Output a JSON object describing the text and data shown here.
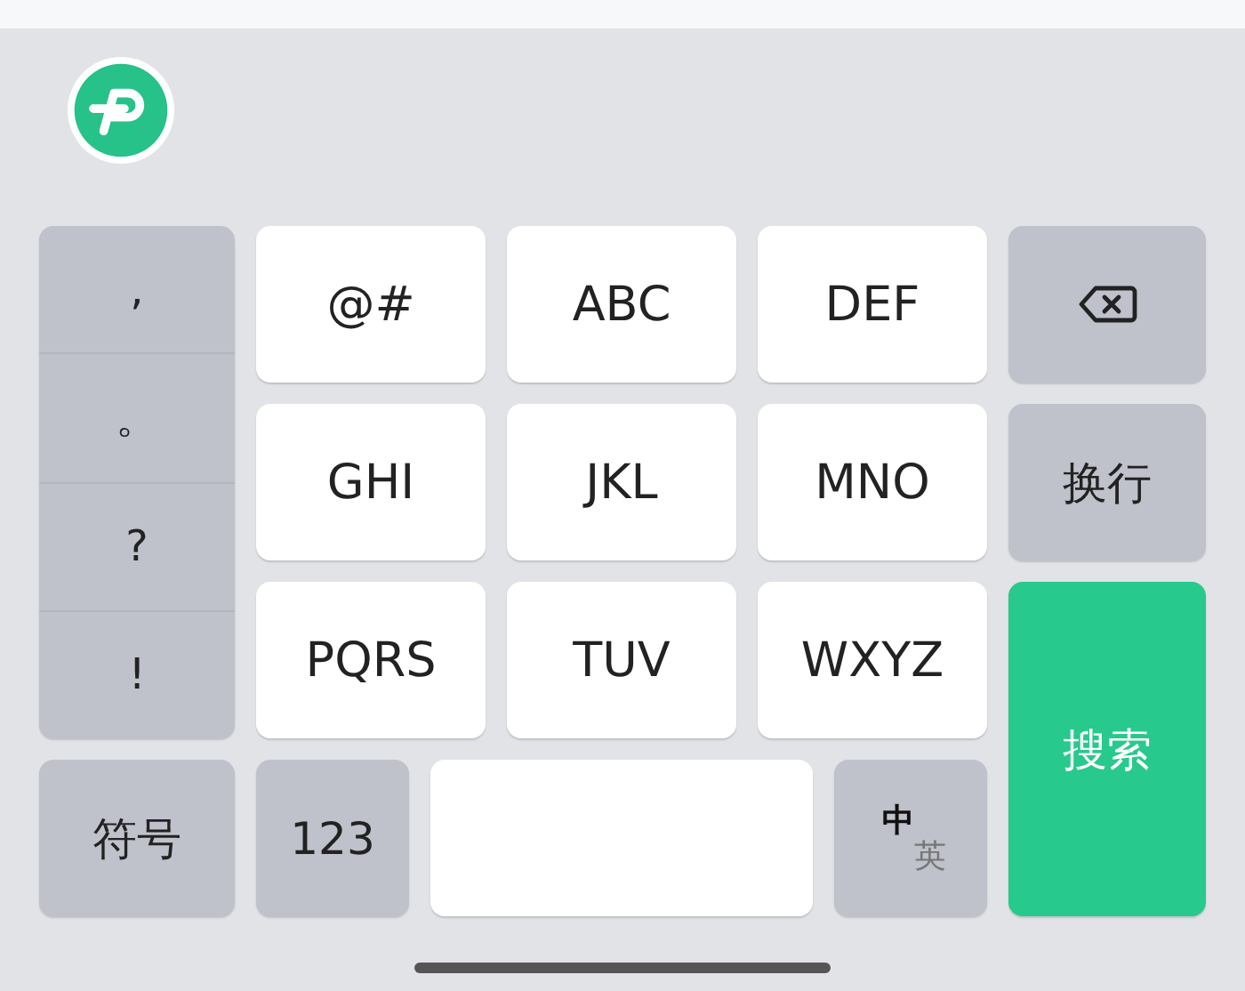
{
  "punctuation": [
    ",",
    "。",
    "?",
    "!"
  ],
  "letter_keys": [
    [
      "@#",
      "ABC",
      "DEF"
    ],
    [
      "GHI",
      "JKL",
      "MNO"
    ],
    [
      "PQRS",
      "TUV",
      "WXYZ"
    ]
  ],
  "side_keys": [
    {
      "kind": "backspace"
    },
    {
      "kind": "text",
      "label": "换行"
    }
  ],
  "search_key": "搜索",
  "bottom": {
    "symbols": "符号",
    "numbers": "123",
    "languages": [
      {
        "label": "中",
        "selected": true
      },
      {
        "label": "英",
        "selected": false
      }
    ]
  }
}
